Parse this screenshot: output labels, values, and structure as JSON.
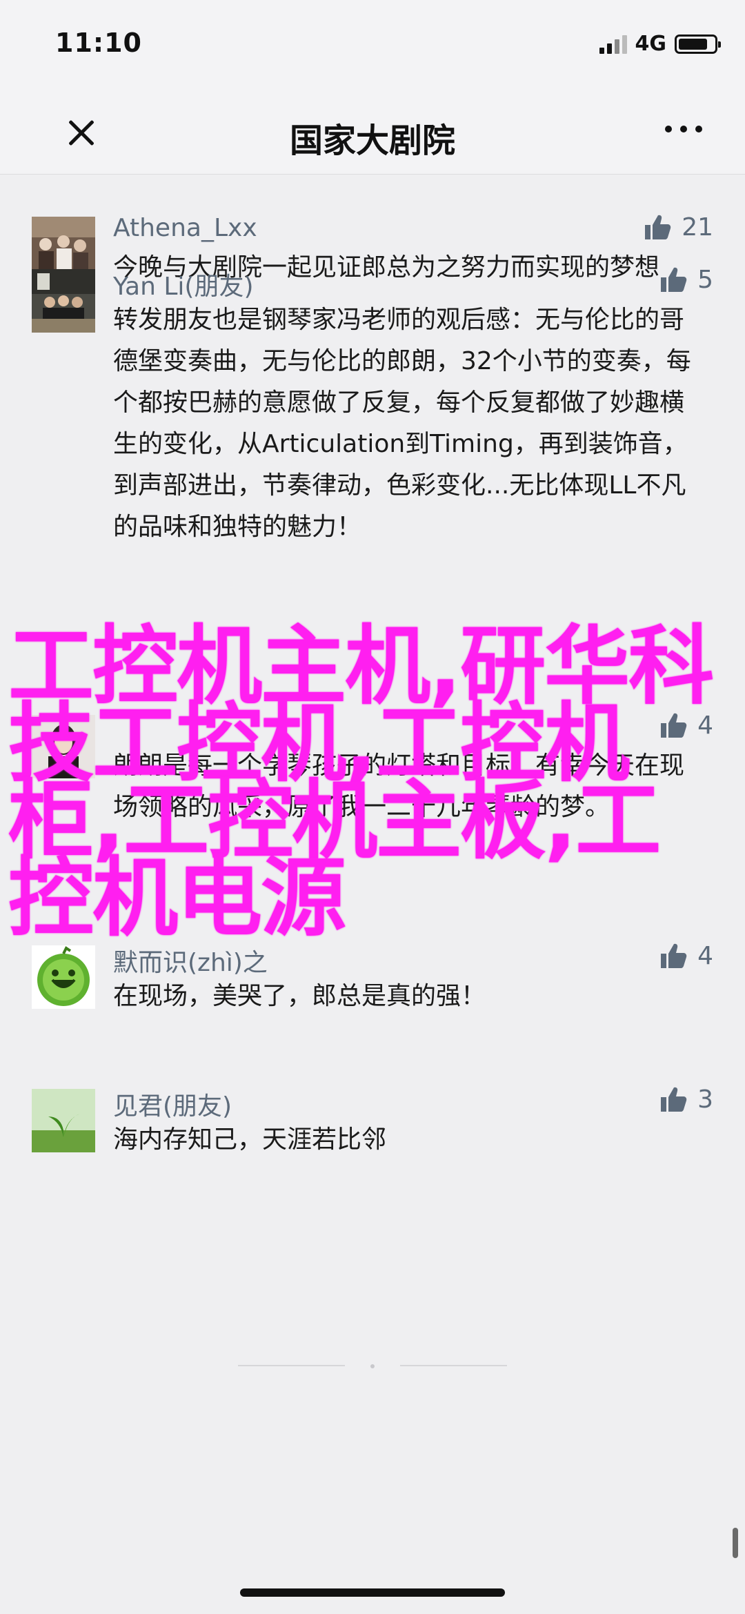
{
  "status_bar": {
    "time": "11:10",
    "network": "4G",
    "battery_level": 0.82
  },
  "nav": {
    "title": "国家大剧院",
    "close_icon": "close-icon",
    "more_icon": "more-dots-icon"
  },
  "comments": [
    {
      "name": "Athena_Lxx",
      "text": "今晚与大剧院一起见证郎总为之努力而实现的梦想",
      "likes": "21",
      "avatar": "stage-photo"
    },
    {
      "name": "Yan Li(朋友)",
      "text": "转发朋友也是钢琴家冯老师的观后感：无与伦比的哥德堡变奏曲，无与伦比的郎朗，32个小节的变奏，每个都按巴赫的意愿做了反复，每个反复都做了妙趣横生的变化，从Articulation到Timing，再到装饰音，到声部进出，节奏律动，色彩变化...无比体现LL不凡的品味和独特的魅力！",
      "likes": "5",
      "avatar": "group-photo"
    },
    {
      "name": "",
      "text": "朗朗是每一个学琴孩子的灯塔和目标，有幸今天在现场领略的风采，原了我一二十几年琴龄的梦。",
      "likes": "4",
      "avatar": "portrait-photo"
    },
    {
      "name": "默而识(zhì)之",
      "text": "在现场，美哭了，郎总是真的强！",
      "likes": "4",
      "avatar": "watermelon-avatar"
    },
    {
      "name": "见君(朋友)",
      "text": "海内存知己，天涯若比邻",
      "likes": "3",
      "avatar": "sprout-avatar"
    }
  ],
  "overlay": {
    "text": "工控机主机,研华科技工控机,工控机柜,工控机主板,工控机电源"
  },
  "colors": {
    "overlay": "#ff1ff0",
    "name": "#5c6a7a",
    "background": "#efeff1"
  }
}
